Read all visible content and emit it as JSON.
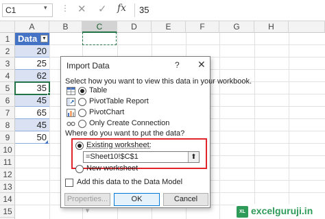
{
  "formula_bar": {
    "name_box": "C1",
    "dots": "⋮",
    "cancel_icon": "✕",
    "enter_icon": "✓",
    "fx": "fx",
    "value": "35"
  },
  "grid": {
    "columns": [
      "A",
      "B",
      "C",
      "D",
      "E",
      "F",
      "G",
      "H"
    ],
    "rows": [
      "1",
      "2",
      "3",
      "4",
      "5",
      "6",
      "7",
      "8",
      "9",
      "10",
      "11",
      "12",
      "13",
      "14",
      "15"
    ],
    "header_cell": "Data",
    "values": [
      "20",
      "25",
      "62",
      "35",
      "45",
      "65",
      "45",
      "50"
    ]
  },
  "dialog": {
    "title": "Import Data",
    "help": "?",
    "close": "✕",
    "view_prompt": "Select how you want to view this data in your workbook.",
    "view_options": [
      "Table",
      "PivotTable Report",
      "PivotChart",
      "Only Create Connection"
    ],
    "selected_view": "Table",
    "location_prompt": "Where do you want to put the data?",
    "existing_worksheet": "Existing worksheet:",
    "range_value": "=Sheet10!$C$1",
    "collapse_icon": "⬆",
    "new_worksheet": "New worksheet",
    "data_model_label": "Add this data to the Data Model",
    "properties_button": "Properties...",
    "properties_caret": "▾",
    "ok_button": "OK",
    "cancel_button": "Cancel"
  },
  "watermark": {
    "logo": "XL",
    "text": "excelguruji.in"
  },
  "colors": {
    "accent": "#217346",
    "table_header": "#4472c4",
    "table_band": "#d9e1f2",
    "highlight_box": "#e0242a"
  }
}
